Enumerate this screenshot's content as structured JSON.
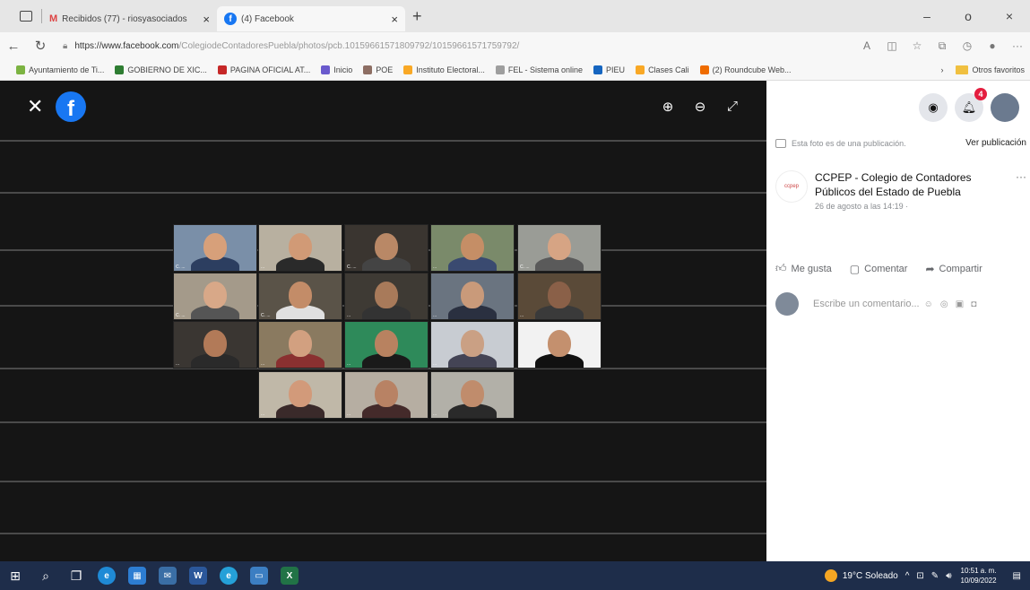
{
  "tabs": [
    {
      "label": "Recibidos (77) - riosyasociados",
      "close": "×"
    },
    {
      "label": "(4) Facebook",
      "close": "×"
    }
  ],
  "new_tab": "+",
  "window_controls": [
    "–",
    "o",
    "×"
  ],
  "address": {
    "host": "https://www.facebook.com",
    "path": "/ColegiodeContadoresPuebla/photos/pcb.10159661571809792/10159661571759792/"
  },
  "favorites": [
    {
      "label": "Ayuntamiento de Ti...",
      "color": "#7cb342"
    },
    {
      "label": "GOBIERNO DE XIC...",
      "color": "#2e7d32"
    },
    {
      "label": "PAGINA OFICIAL AT...",
      "color": "#c62828"
    },
    {
      "label": "Inicio",
      "color": "#6a5acd"
    },
    {
      "label": "POE",
      "color": "#8d6e63"
    },
    {
      "label": "Instituto Electoral...",
      "color": "#f9a825"
    },
    {
      "label": "FEL - Sistema online",
      "color": "#9e9e9e"
    },
    {
      "label": "PIEU",
      "color": "#1565c0"
    },
    {
      "label": "Clases Cali",
      "color": "#f9a825"
    },
    {
      "label": "(2) Roundcube Web...",
      "color": "#ef6c00"
    }
  ],
  "favorites_more": "Otros favoritos",
  "viewer": {
    "tiles": [
      {
        "bg": "#7a8fa8",
        "face": "#d7a07a",
        "shirt": "#2c3e60",
        "name": "C. ..."
      },
      {
        "bg": "#b8b0a0",
        "face": "#d19a76",
        "shirt": "#2a2a2a",
        "name": "..."
      },
      {
        "bg": "#3a3530",
        "face": "#b98866",
        "shirt": "#444",
        "name": "C. ..."
      },
      {
        "bg": "#7a8a6a",
        "face": "#c58e66",
        "shirt": "#3a4a70",
        "name": "..."
      },
      {
        "bg": "#9a9c96",
        "face": "#d6a484",
        "shirt": "#5a5a5a",
        "name": "C. ..."
      },
      {
        "bg": "#a49a8a",
        "face": "#d8a888",
        "shirt": "#555",
        "name": "C. ..."
      },
      {
        "bg": "#5a5348",
        "face": "#c38c68",
        "shirt": "#e0e0e0",
        "name": "C. ..."
      },
      {
        "bg": "#3e3a34",
        "face": "#a87a5a",
        "shirt": "#333",
        "name": "..."
      },
      {
        "bg": "#6a7480",
        "face": "#c99a7a",
        "shirt": "#2a3040",
        "name": "..."
      },
      {
        "bg": "#5a4a38",
        "face": "#8a6048",
        "shirt": "#3a3a3a",
        "name": "..."
      },
      {
        "bg": "#3a3632",
        "face": "#b27a58",
        "shirt": "#2a2a2a",
        "name": "..."
      },
      {
        "bg": "#8a7a60",
        "face": "#d2a080",
        "shirt": "#8a3030",
        "name": "..."
      },
      {
        "bg": "#2e8a5a",
        "face": "#b88260",
        "shirt": "#1a1a1a",
        "name": "..."
      },
      {
        "bg": "#c8ccd2",
        "face": "#caa084",
        "shirt": "#445",
        "name": "..."
      },
      {
        "bg": "#f2f2f2",
        "face": "#c4906e",
        "shirt": "#111",
        "name": "..."
      },
      {
        "bg": "#c0b8a8",
        "face": "#d29a7a",
        "shirt": "#3a2a2a",
        "name": "..."
      },
      {
        "bg": "#b6aea2",
        "face": "#b88264",
        "shirt": "#442a2a",
        "name": "..."
      },
      {
        "bg": "#b2b0a8",
        "face": "#c08c6c",
        "shirt": "#2a2a2a",
        "name": "..."
      }
    ]
  },
  "side": {
    "notifications_count": "4",
    "publication_note": "Esta foto es de una publicación.",
    "view_post": "Ver publicación",
    "author_name": "CCPEP - Colegio de Contadores Públicos del Estado de Puebla",
    "author_logo": "ccpep",
    "date": "26 de agosto a las 14:19 ·",
    "more": "···",
    "actions": [
      "Me gusta",
      "Comentar",
      "Compartir"
    ],
    "comment_placeholder": "Escribe un comentario..."
  },
  "taskbar": {
    "weather": "19°C Soleado",
    "time": "10:51 a. m.",
    "date": "10/09/2022"
  }
}
